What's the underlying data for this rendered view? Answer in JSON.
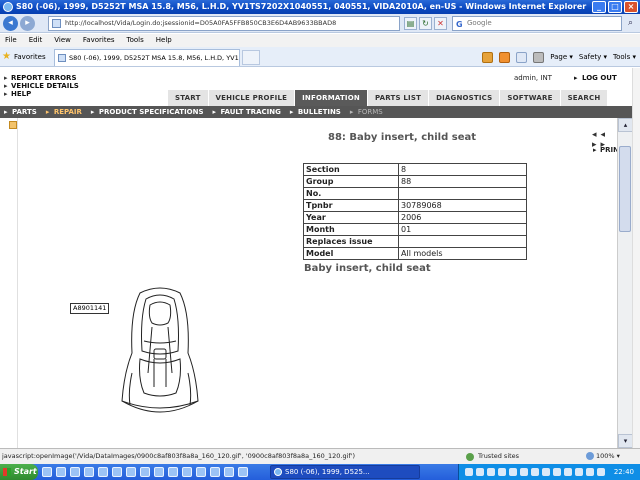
{
  "window": {
    "title": "S80 (-06), 1999, D5252T MSA 15.8, M56, L.H.D, YV1TS7202X1040551, 040551, VIDA2010A, en-US - Windows Internet Explorer"
  },
  "addressbar": {
    "url": "http://localhost/Vida/Login.do;jsessionid=D05A0FA5FFB850CB3E6D4AB9633BBAD8",
    "search_placeholder": "Google"
  },
  "menu": [
    "File",
    "Edit",
    "View",
    "Favorites",
    "Tools",
    "Help"
  ],
  "favorites": {
    "label": "Favorites",
    "tab_title": "S80 (-06), 1999, D5252T MSA 15.8, M56, L.H.D, YV1...",
    "commands": [
      "Page ▾",
      "Safety ▾",
      "Tools ▾"
    ]
  },
  "vida": {
    "header_links": [
      "REPORT ERRORS",
      "VEHICLE DETAILS",
      "HELP"
    ],
    "user": "admin, INT",
    "logout": "LOG OUT",
    "main_tabs": [
      {
        "label": "START",
        "active": false
      },
      {
        "label": "VEHICLE PROFILE",
        "active": false
      },
      {
        "label": "INFORMATION",
        "active": true
      },
      {
        "label": "PARTS LIST",
        "active": false
      },
      {
        "label": "DIAGNOSTICS",
        "active": false
      },
      {
        "label": "SOFTWARE",
        "active": false
      },
      {
        "label": "SEARCH",
        "active": false
      }
    ],
    "sub_tabs": [
      {
        "label": "PARTS",
        "state": "normal"
      },
      {
        "label": "REPAIR",
        "state": "active"
      },
      {
        "label": "PRODUCT SPECIFICATIONS",
        "state": "normal"
      },
      {
        "label": "FAULT TRACING",
        "state": "normal"
      },
      {
        "label": "BULLETINS",
        "state": "normal"
      },
      {
        "label": "FORMS",
        "state": "disabled"
      }
    ]
  },
  "document": {
    "title": "88: Baby insert, child seat",
    "nav_arrows": "◂◂ ▸▸",
    "print_label": "PRINT",
    "table": [
      {
        "key": "Section",
        "value": "8"
      },
      {
        "key": "Group",
        "value": "88"
      },
      {
        "key": "No.",
        "value": ""
      },
      {
        "key": "Tpnbr",
        "value": "30789068"
      },
      {
        "key": "Year",
        "value": "2006"
      },
      {
        "key": "Month",
        "value": "01"
      },
      {
        "key": "Replaces issue",
        "value": ""
      },
      {
        "key": "Model",
        "value": "All models"
      }
    ],
    "subtitle": "Baby insert, child seat",
    "image_label": "A8901141"
  },
  "statusbar": {
    "text": "javascript:openImage('/Vida/DataImages/0900c8af803f8a8a_160_120.gif', '0900c8af803f8a8a_160_120.gif')",
    "zone": "Trusted sites",
    "zoom": "100% ▾"
  },
  "taskbar": {
    "start": "Start",
    "task": "S80 (-06), 1999, D525...",
    "clock": "22:40"
  }
}
